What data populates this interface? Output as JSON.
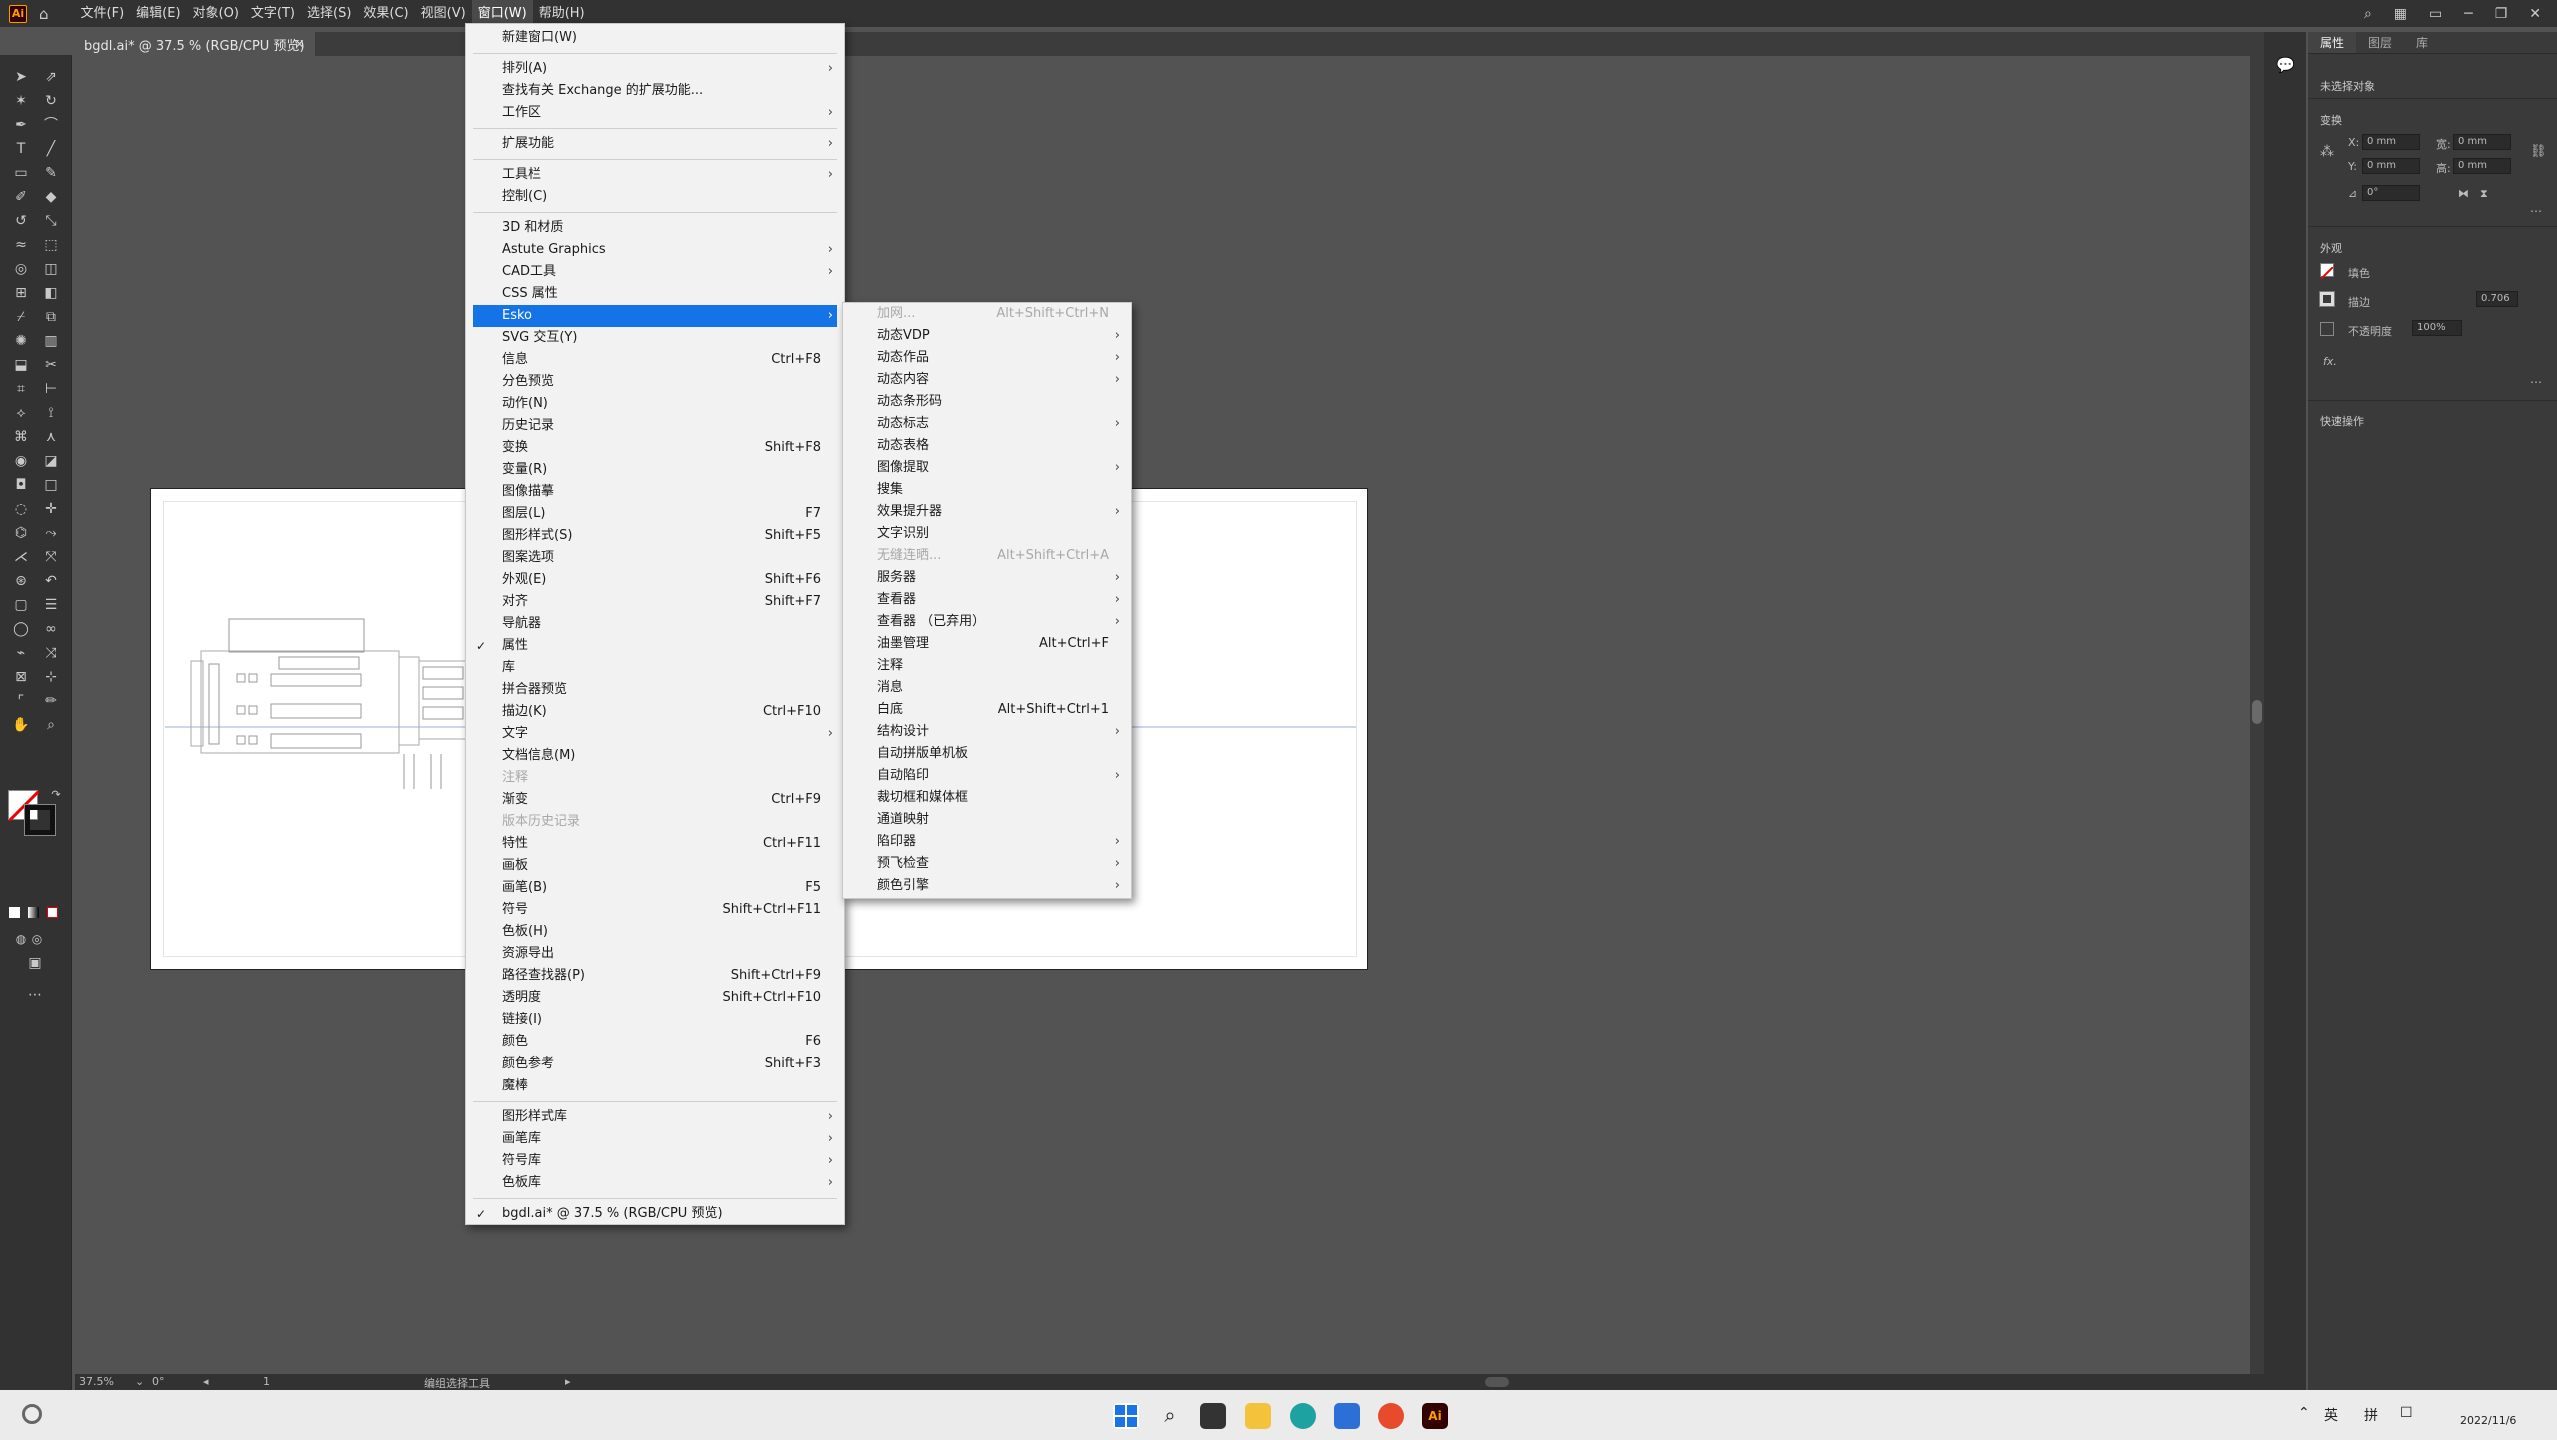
{
  "app": {
    "logo": "Ai"
  },
  "menubar": {
    "items": [
      "文件(F)",
      "编辑(E)",
      "对象(O)",
      "文字(T)",
      "选择(S)",
      "效果(C)",
      "视图(V)",
      "窗口(W)",
      "帮助(H)"
    ],
    "active_index": 7
  },
  "document": {
    "tab_title": "bgdl.ai* @ 37.5 % (RGB/CPU 预览)",
    "close_icon": "×"
  },
  "window_menu": {
    "items": [
      {
        "label": "新建窗口(W)"
      },
      {
        "sep": true
      },
      {
        "label": "排列(A)",
        "submenu": true
      },
      {
        "label": "查找有关 Exchange 的扩展功能..."
      },
      {
        "label": "工作区",
        "submenu": true
      },
      {
        "sep": true
      },
      {
        "label": "扩展功能",
        "submenu": true
      },
      {
        "sep": true
      },
      {
        "label": "工具栏",
        "submenu": true
      },
      {
        "label": "控制(C)"
      },
      {
        "sep": true
      },
      {
        "label": "3D 和材质"
      },
      {
        "label": "Astute Graphics",
        "submenu": true
      },
      {
        "label": "CAD工具",
        "submenu": true
      },
      {
        "label": "CSS 属性"
      },
      {
        "label": "Esko",
        "submenu": true,
        "highlight": true
      },
      {
        "label": "SVG 交互(Y)"
      },
      {
        "label": "信息",
        "shortcut": "Ctrl+F8"
      },
      {
        "label": "分色预览"
      },
      {
        "label": "动作(N)"
      },
      {
        "label": "历史记录"
      },
      {
        "label": "变换",
        "shortcut": "Shift+F8"
      },
      {
        "label": "变量(R)"
      },
      {
        "label": "图像描摹"
      },
      {
        "label": "图层(L)",
        "shortcut": "F7"
      },
      {
        "label": "图形样式(S)",
        "shortcut": "Shift+F5"
      },
      {
        "label": "图案选项"
      },
      {
        "label": "外观(E)",
        "shortcut": "Shift+F6"
      },
      {
        "label": "对齐",
        "shortcut": "Shift+F7"
      },
      {
        "label": "导航器"
      },
      {
        "label": "属性",
        "checked": true
      },
      {
        "label": "库"
      },
      {
        "label": "拼合器预览"
      },
      {
        "label": "描边(K)",
        "shortcut": "Ctrl+F10"
      },
      {
        "label": "文字",
        "submenu": true
      },
      {
        "label": "文档信息(M)"
      },
      {
        "label": "注释",
        "disabled": true
      },
      {
        "label": "渐变",
        "shortcut": "Ctrl+F9"
      },
      {
        "label": "版本历史记录",
        "disabled": true
      },
      {
        "label": "特性",
        "shortcut": "Ctrl+F11"
      },
      {
        "label": "画板"
      },
      {
        "label": "画笔(B)",
        "shortcut": "F5"
      },
      {
        "label": "符号",
        "shortcut": "Shift+Ctrl+F11"
      },
      {
        "label": "色板(H)"
      },
      {
        "label": "资源导出"
      },
      {
        "label": "路径查找器(P)",
        "shortcut": "Shift+Ctrl+F9"
      },
      {
        "label": "透明度",
        "shortcut": "Shift+Ctrl+F10"
      },
      {
        "label": "链接(I)"
      },
      {
        "label": "颜色",
        "shortcut": "F6"
      },
      {
        "label": "颜色参考",
        "shortcut": "Shift+F3"
      },
      {
        "label": "魔棒"
      },
      {
        "sep": true
      },
      {
        "label": "图形样式库",
        "submenu": true
      },
      {
        "label": "画笔库",
        "submenu": true
      },
      {
        "label": "符号库",
        "submenu": true
      },
      {
        "label": "色板库",
        "submenu": true
      },
      {
        "sep": true
      },
      {
        "label": "bgdl.ai* @ 37.5 % (RGB/CPU 预览)",
        "checked": true
      }
    ]
  },
  "esko_menu": {
    "items": [
      {
        "label": "加网...",
        "shortcut": "Alt+Shift+Ctrl+N",
        "disabled": true
      },
      {
        "label": "动态VDP",
        "submenu": true
      },
      {
        "label": "动态作品",
        "submenu": true
      },
      {
        "label": "动态内容",
        "submenu": true
      },
      {
        "label": "动态条形码"
      },
      {
        "label": "动态标志",
        "submenu": true
      },
      {
        "label": "动态表格"
      },
      {
        "label": "图像提取",
        "submenu": true
      },
      {
        "label": "搜集"
      },
      {
        "label": "效果提升器",
        "submenu": true
      },
      {
        "label": "文字识别"
      },
      {
        "label": "无缝连晒...",
        "shortcut": "Alt+Shift+Ctrl+A",
        "disabled": true
      },
      {
        "label": "服务器",
        "submenu": true
      },
      {
        "label": "查看器",
        "submenu": true
      },
      {
        "label": "查看器 （已弃用）",
        "submenu": true
      },
      {
        "label": "油墨管理",
        "shortcut": "Alt+Ctrl+F"
      },
      {
        "label": "注释"
      },
      {
        "label": "消息"
      },
      {
        "label": "白底",
        "shortcut": "Alt+Shift+Ctrl+1"
      },
      {
        "label": "结构设计",
        "submenu": true
      },
      {
        "label": "自动拼版单机板"
      },
      {
        "label": "自动陷印",
        "submenu": true
      },
      {
        "label": "裁切框和媒体框"
      },
      {
        "label": "通道映射"
      },
      {
        "label": "陷印器",
        "submenu": true
      },
      {
        "label": "预飞检查",
        "submenu": true
      },
      {
        "label": "颜色引擎",
        "submenu": true
      }
    ]
  },
  "right_panel": {
    "tabs": [
      "属性",
      "图层",
      "库"
    ],
    "no_selection": "未选择对象",
    "transform_title": "变换",
    "x_label": "X:",
    "y_label": "Y:",
    "w_label": "宽:",
    "h_label": "高:",
    "x_value": "0 mm",
    "y_value": "0 mm",
    "w_value": "0 mm",
    "h_value": "0 mm",
    "angle_value": "0°",
    "appearance_title": "外观",
    "fill_label": "填色",
    "stroke_label": "描边",
    "stroke_value": "0.706",
    "opacity_label": "不透明度",
    "opacity_value": "100%",
    "fx": "fx.",
    "quick_actions": "快速操作"
  },
  "status": {
    "zoom": "37.5%",
    "rotate": "0°",
    "artboard": "1",
    "tool": "编组选择工具"
  },
  "taskbar": {
    "lang": "英",
    "ime": "拼",
    "time": "2022/11/6"
  },
  "colors": {
    "accent": "#1473e6",
    "menubar": "#323232",
    "canvas": "#535353"
  }
}
